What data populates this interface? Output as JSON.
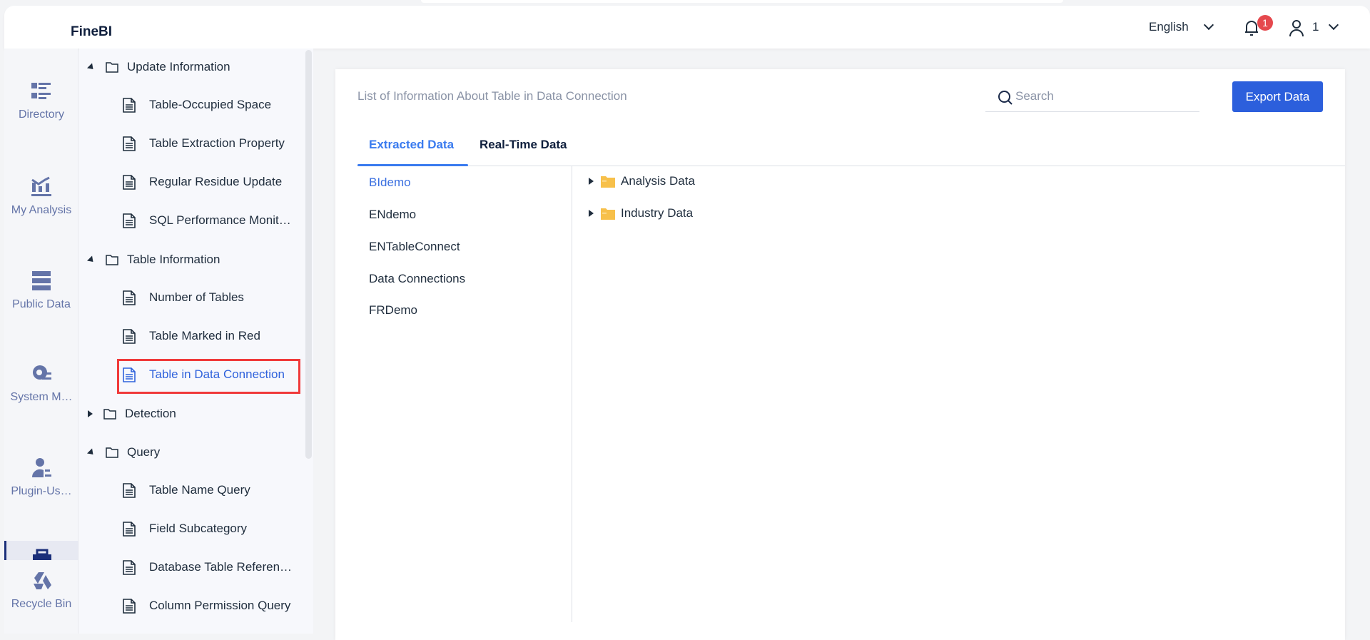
{
  "header": {
    "logo": "FineBI",
    "language": "English",
    "notification_count": "1",
    "user": "1"
  },
  "rail": [
    {
      "label": "Directory",
      "icon": "directory-icon"
    },
    {
      "label": "My Analysis",
      "icon": "analysis-icon"
    },
    {
      "label": "Public Data",
      "icon": "public-data-icon"
    },
    {
      "label": "System M…",
      "icon": "system-management-icon"
    },
    {
      "label": "Plugin-Us…",
      "icon": "plugin-user-icon"
    },
    {
      "label": "Recycle Bin",
      "icon": "recycle-bin-icon"
    }
  ],
  "tree": {
    "groups": [
      {
        "label": "Update Information",
        "expanded": true,
        "items": [
          "Table-Occupied Space",
          "Table Extraction Property",
          "Regular Residue Update",
          "SQL Performance Monit…"
        ]
      },
      {
        "label": "Table Information",
        "expanded": true,
        "items": [
          "Number of Tables",
          "Table Marked in Red",
          "Table in Data Connection"
        ]
      },
      {
        "label": "Detection",
        "expanded": false,
        "items": []
      },
      {
        "label": "Query",
        "expanded": true,
        "items": [
          "Table Name Query",
          "Field Subcategory",
          "Database Table Referen…",
          "Column Permission Query"
        ]
      }
    ],
    "selected": "Table in Data Connection"
  },
  "main": {
    "title": "List of Information About Table in Data Connection",
    "search_placeholder": "Search",
    "export_label": "Export Data",
    "tabs": [
      {
        "label": "Extracted Data",
        "active": true
      },
      {
        "label": "Real-Time Data",
        "active": false
      }
    ],
    "connections": [
      "BIdemo",
      "ENdemo",
      "ENTableConnect",
      "Data Connections",
      "FRDemo"
    ],
    "selected_connection": "BIdemo",
    "folders": [
      "Analysis Data",
      "Industry Data"
    ]
  },
  "colors": {
    "accent": "#2c5fdc",
    "tab_active": "#3a7bef",
    "highlight": "#f03a3a",
    "folder": "#f7c04a"
  }
}
